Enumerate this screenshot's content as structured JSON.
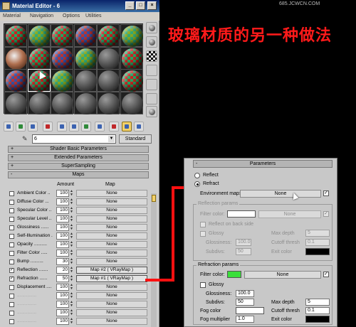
{
  "window": {
    "title": "Material Editor - 6",
    "menu": [
      "Material",
      "Navigation",
      "Options",
      "Utilities"
    ],
    "min_label": "_",
    "max_label": "□",
    "close_label": "×"
  },
  "material_name": "6",
  "type_button": "Standard",
  "rollouts": [
    {
      "label": "Shader Basic Parameters",
      "sign": "+"
    },
    {
      "label": "Extended Parameters",
      "sign": "+"
    },
    {
      "label": "SuperSampling",
      "sign": "+"
    },
    {
      "label": "Maps",
      "sign": "-"
    }
  ],
  "maps": {
    "col_amount": "Amount",
    "col_map": "Map",
    "rows": [
      {
        "label": "Ambient Color ..",
        "checked": false,
        "amount": "100",
        "map": "None"
      },
      {
        "label": "Diffuse Color ...",
        "checked": false,
        "amount": "100",
        "map": "None"
      },
      {
        "label": "Specular Color ..",
        "checked": false,
        "amount": "100",
        "map": "None"
      },
      {
        "label": "Specular Level ..",
        "checked": false,
        "amount": "100",
        "map": "None"
      },
      {
        "label": "Glossiness ......",
        "checked": false,
        "amount": "100",
        "map": "None"
      },
      {
        "label": "Self-Illumination .",
        "checked": false,
        "amount": "100",
        "map": "None"
      },
      {
        "label": "Opacity ..........",
        "checked": false,
        "amount": "100",
        "map": "None"
      },
      {
        "label": "Filter Color .....",
        "checked": false,
        "amount": "100",
        "map": "None"
      },
      {
        "label": "Bump ..........",
        "checked": false,
        "amount": "30",
        "map": "None"
      },
      {
        "label": "Reflection .......",
        "checked": true,
        "amount": "20",
        "map": "Map #2  ( VRayMap )"
      },
      {
        "label": "Refraction ......",
        "checked": true,
        "amount": "50",
        "map": "Map #1  ( VRayMap )"
      },
      {
        "label": "Displacement ....",
        "checked": false,
        "amount": "100",
        "map": "None"
      },
      {
        "label": "...............",
        "checked": false,
        "amount": "100",
        "map": "None",
        "dim": true
      },
      {
        "label": "...............",
        "checked": false,
        "amount": "100",
        "map": "None",
        "dim": true
      },
      {
        "label": "...............",
        "checked": false,
        "amount": "100",
        "map": "None",
        "dim": true
      },
      {
        "label": "...............",
        "checked": false,
        "amount": "100",
        "map": "None",
        "dim": true
      }
    ]
  },
  "heading_cn": "玻璃材质的另一种做法",
  "watermark": "685.JCWCN.COM",
  "params": {
    "title": "Parameters",
    "title_sign": "-",
    "reflect_label": "Reflect",
    "refract_label": "Refract",
    "env_map_label": "Environment map:",
    "env_map_value": "None",
    "reflection_group": "Reflection params",
    "refl_filter_label": "Filter color:",
    "refl_filter_map": "None",
    "reflect_backside": "Reflect on back side",
    "refl_glossy": "Glossy",
    "refl_glossiness_label": "Glossiness:",
    "refl_glossiness_value": "100.0",
    "refl_subdivs_label": "Subdivs:",
    "refl_subdivs_value": "50",
    "refl_maxdepth_label": "Max depth",
    "refl_maxdepth_value": "5",
    "refl_cutoff_label": "Cutoff thresh",
    "refl_cutoff_value": "0.1",
    "refl_exit_label": "Exit color",
    "refraction_group": "Refraction params",
    "refr_filter_label": "Filter color:",
    "refr_filter_map": "None",
    "refr_glossy": "Glossy",
    "refr_glossiness_label": "Glossiness:",
    "refr_glossiness_value": "100.0",
    "refr_subdivs_label": "Subdivs:",
    "refr_subdivs_value": "50",
    "refr_maxdepth_label": "Max depth",
    "refr_maxdepth_value": "5",
    "refr_cutoff_label": "Cutoff thresh",
    "refr_cutoff_value": "0.1",
    "fog_color_label": "Fog color",
    "exit_color_label": "Exit color",
    "fog_mult_label": "Fog multiplier",
    "fog_mult_value": "1.0"
  },
  "colors": {
    "refr_filter": "#3adf3a",
    "refl_filter": "#ffffff",
    "refl_exit": "#000000",
    "fog": "#ffffff",
    "refr_exit": "#000000",
    "accent_red": "#ff1010"
  }
}
